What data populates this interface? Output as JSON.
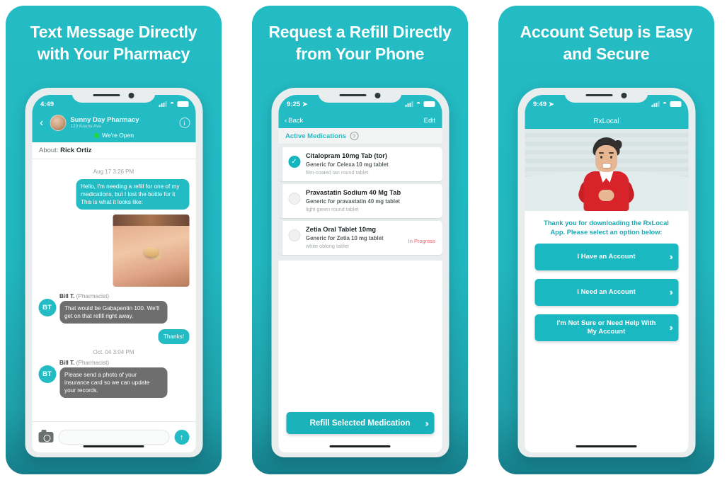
{
  "brand": {
    "teal": "#24bcc4",
    "teal_dark": "#157d89",
    "red": "#d8232a",
    "alert": "#f0626b"
  },
  "panels": [
    {
      "headline": "Text Message Directly\nwith Your Pharmacy",
      "headline_line1": "Text Message Directly",
      "headline_line2": "with Your Pharmacy",
      "status": {
        "time": "4:49",
        "wifi": "wifi-icon",
        "battery": "battery-icon"
      },
      "chat": {
        "back": "‹",
        "pharmacy_name": "Sunny Day Pharmacy",
        "pharmacy_address": "123 Kouns Ave",
        "info": "i",
        "open_status": "We're Open",
        "about_label": "About:",
        "about_value": "Rick Ortiz",
        "messages": [
          {
            "type": "timestamp",
            "text": "Aug  17 3:26 PM"
          },
          {
            "type": "outgoing",
            "text": "Hello, I'm needing a refill for one of my medications, but I lost the bottle for it This is what it looks like:"
          },
          {
            "type": "photo",
            "alt": "pill-in-hand-photo"
          },
          {
            "type": "incoming",
            "initials": "BT",
            "sender_name": "Bill T.",
            "sender_role": "(Pharmacist)",
            "text": "That would be Gabapentin 100. We'll get on that refill right away."
          },
          {
            "type": "outgoing",
            "text": "Thanks!"
          },
          {
            "type": "timestamp",
            "text": "Oct. 04 3:04 PM"
          },
          {
            "type": "incoming",
            "initials": "BT",
            "sender_name": "Bill T.",
            "sender_role": "(Pharmacist)",
            "text": "Please send a photo of your insurance card so we can update your records."
          }
        ],
        "composer": {
          "camera": "camera-icon",
          "placeholder": "",
          "send": "↑"
        }
      }
    },
    {
      "headline_line1": "Request a Refill Directly",
      "headline_line2": "from Your Phone",
      "status": {
        "time": "9:25"
      },
      "meds": {
        "back_label": "Back",
        "edit_label": "Edit",
        "section_title": "Active Medications",
        "help_glyph": "?",
        "items": [
          {
            "name": "Citalopram 10mg Tab (tor)",
            "generic": "Generic for Celexa 10 mg tablet",
            "desc": "film-coated tan round tablet",
            "selected": true,
            "status": ""
          },
          {
            "name": "Pravastatin Sodium 40 Mg Tab",
            "generic": "Generic for pravastatin 40 mg tablet",
            "desc": "light green round tablet",
            "selected": false,
            "status": ""
          },
          {
            "name": "Zetia Oral Tablet 10mg",
            "generic": "Generic for Zetia 10 mg tablet",
            "desc": "white oblong tablet",
            "selected": false,
            "status": "In Progress"
          }
        ],
        "cta_label": "Refill Selected Medication"
      }
    },
    {
      "headline_line1": "Account Setup is Easy",
      "headline_line2": "and Secure",
      "status": {
        "time": "9:49"
      },
      "onboarding": {
        "app_title": "RxLocal",
        "illustration": "man-in-red-shirt-illustration",
        "intro_line1": "Thank you for downloading the RxLocal",
        "intro_line2": "App. Please select an option below:",
        "options": [
          {
            "label": "I Have an Account"
          },
          {
            "label": "I Need an Account"
          },
          {
            "label": "I'm Not Sure or Need Help With My Account"
          }
        ]
      }
    }
  ]
}
